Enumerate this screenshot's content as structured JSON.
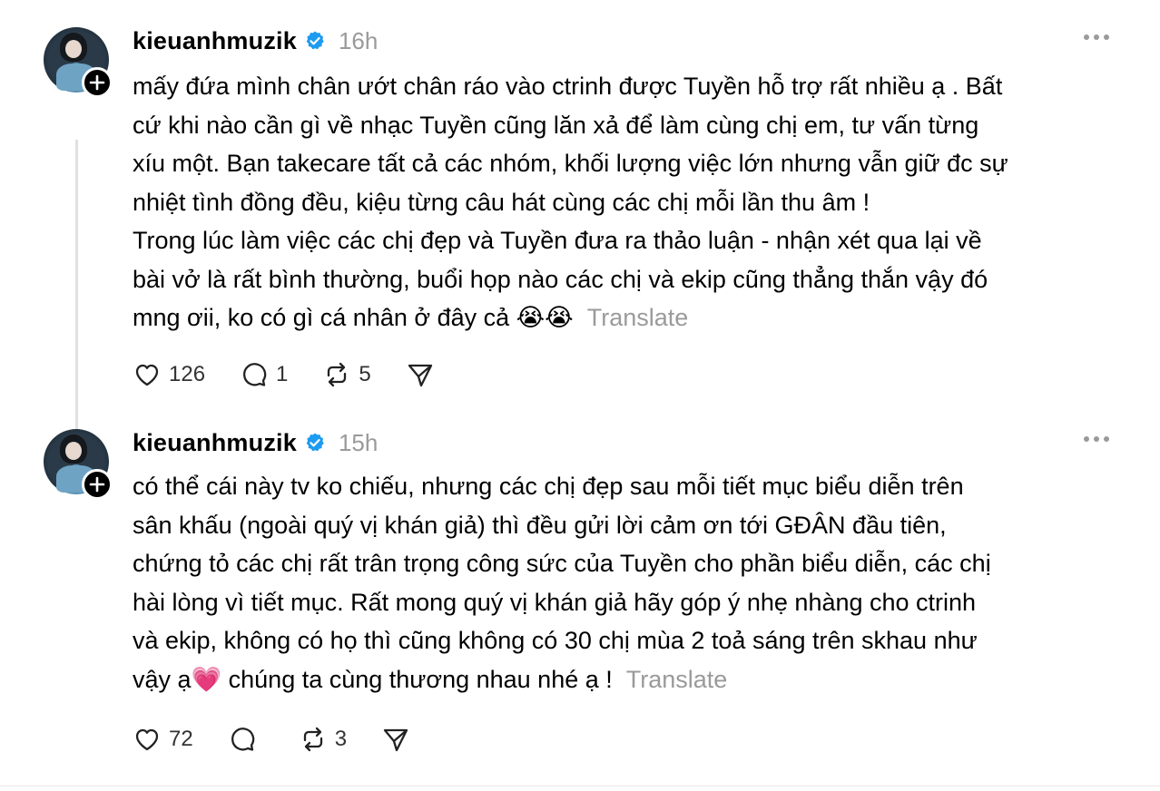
{
  "posts": [
    {
      "username": "kieuanhmuzik",
      "time": "16h",
      "lines": [
        "mấy đứa mình chân ướt chân ráo vào ctrinh được Tuyền hỗ trợ rất nhiều ạ . Bất",
        "cứ khi nào cần gì về nhạc Tuyền cũng lăn xả để làm cùng chị em, tư vấn từng",
        "xíu một. Bạn takecare tất cả các nhóm, khối lượng việc lớn nhưng vẫn giữ đc sự",
        "nhiệt tình đồng đều, kiệu từng câu hát cùng các chị mỗi lần thu âm !",
        "Trong lúc làm việc các chị đẹp và Tuyền đưa ra thảo luận - nhận xét qua lại về",
        "bài vở là rất bình thường, buổi họp nào các chị và ekip cũng thẳng thắn vậy đó",
        "mng ơii, ko có gì cá nhân ở đây cả 😭😭"
      ],
      "translate": "Translate",
      "likes": "126",
      "replies": "1",
      "reposts": "5"
    },
    {
      "username": "kieuanhmuzik",
      "time": "15h",
      "lines": [
        "có thể cái này tv ko chiếu, nhưng các chị đẹp sau mỗi tiết mục biểu diễn trên",
        "sân khấu (ngoài quý vị khán giả) thì đều gửi lời cảm ơn tới GĐÂN đầu tiên,",
        "chứng tỏ các chị rất trân trọng công sức của Tuyền cho phần biểu diễn, các chị",
        "hài lòng vì tiết mục. Rất mong quý vị khán giả hãy góp ý nhẹ nhàng cho ctrinh",
        "và ekip, không có họ thì cũng không có 30 chị mùa 2 toả sáng trên skhau như",
        "vậy ạ💗 chúng ta cùng thương nhau nhé ạ !"
      ],
      "translate": "Translate",
      "likes": "72",
      "replies": "",
      "reposts": "3"
    }
  ],
  "colors": {
    "verified": "#1d9bf0",
    "muted": "#9a9a9a"
  },
  "icons": {
    "verified": "verified-badge-icon",
    "more": "more-options-icon",
    "follow": "follow-plus-icon",
    "like": "heart-icon",
    "reply": "comment-icon",
    "repost": "repost-icon",
    "share": "share-send-icon"
  }
}
